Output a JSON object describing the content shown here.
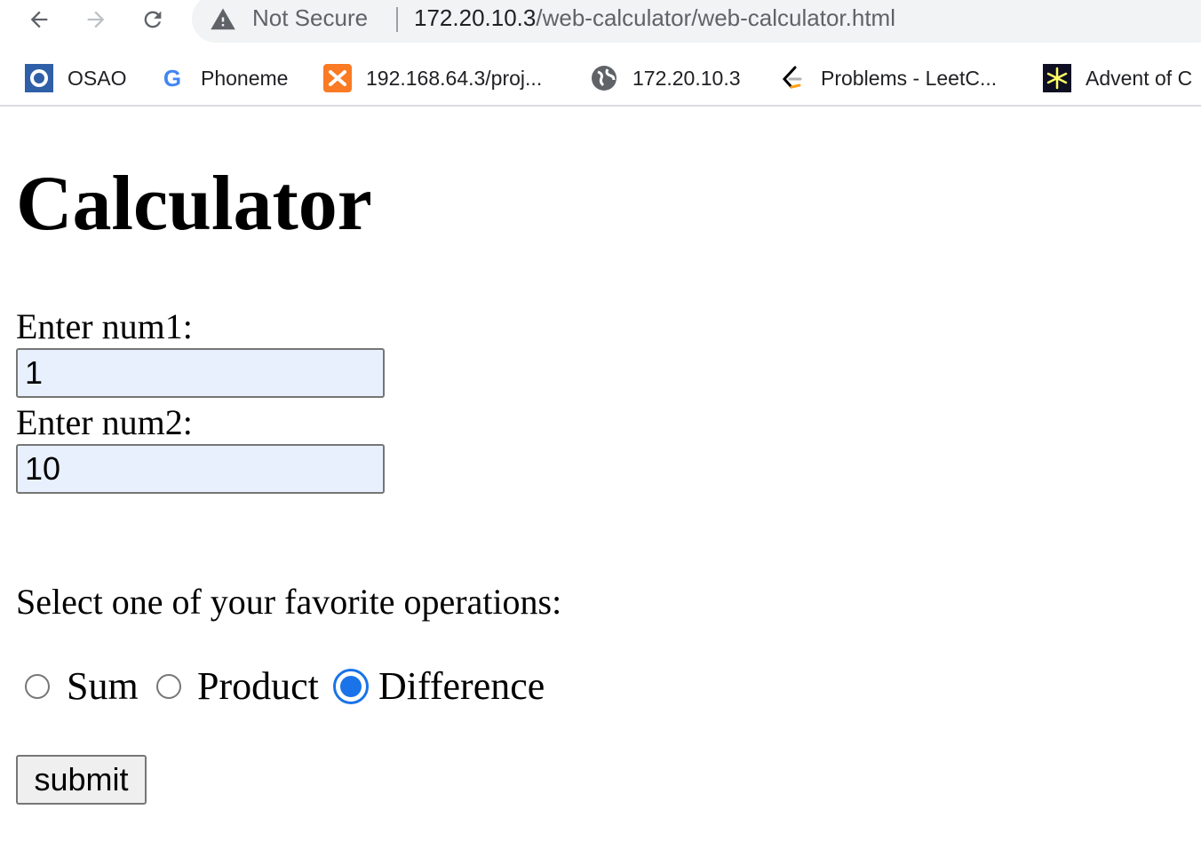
{
  "browser": {
    "security_label": "Not Secure",
    "url_host": "172.20.10.3",
    "url_path": "/web-calculator/web-calculator.html",
    "bookmarks": [
      {
        "label": "OSAO",
        "icon": "osao-icon"
      },
      {
        "label": "Phoneme",
        "icon": "google-icon"
      },
      {
        "label": "192.168.64.3/proj...",
        "icon": "xampp-icon"
      },
      {
        "label": "172.20.10.3",
        "icon": "globe-icon"
      },
      {
        "label": "Problems - LeetC...",
        "icon": "leetcode-icon"
      },
      {
        "label": "Advent of C",
        "icon": "advent-star-icon"
      }
    ]
  },
  "page": {
    "title": "Calculator",
    "num1_label": "Enter num1:",
    "num1_value": "1",
    "num2_label": "Enter num2:",
    "num2_value": "10",
    "operations_prompt": "Select one of your favorite operations:",
    "operations": [
      {
        "label": "Sum",
        "checked": false
      },
      {
        "label": "Product",
        "checked": false
      },
      {
        "label": "Difference",
        "checked": true
      }
    ],
    "submit_label": "submit"
  },
  "colors": {
    "autofill_bg": "#e8f0fe",
    "radio_accent": "#1a73e8",
    "omnibox_bg": "#f1f3f4"
  }
}
